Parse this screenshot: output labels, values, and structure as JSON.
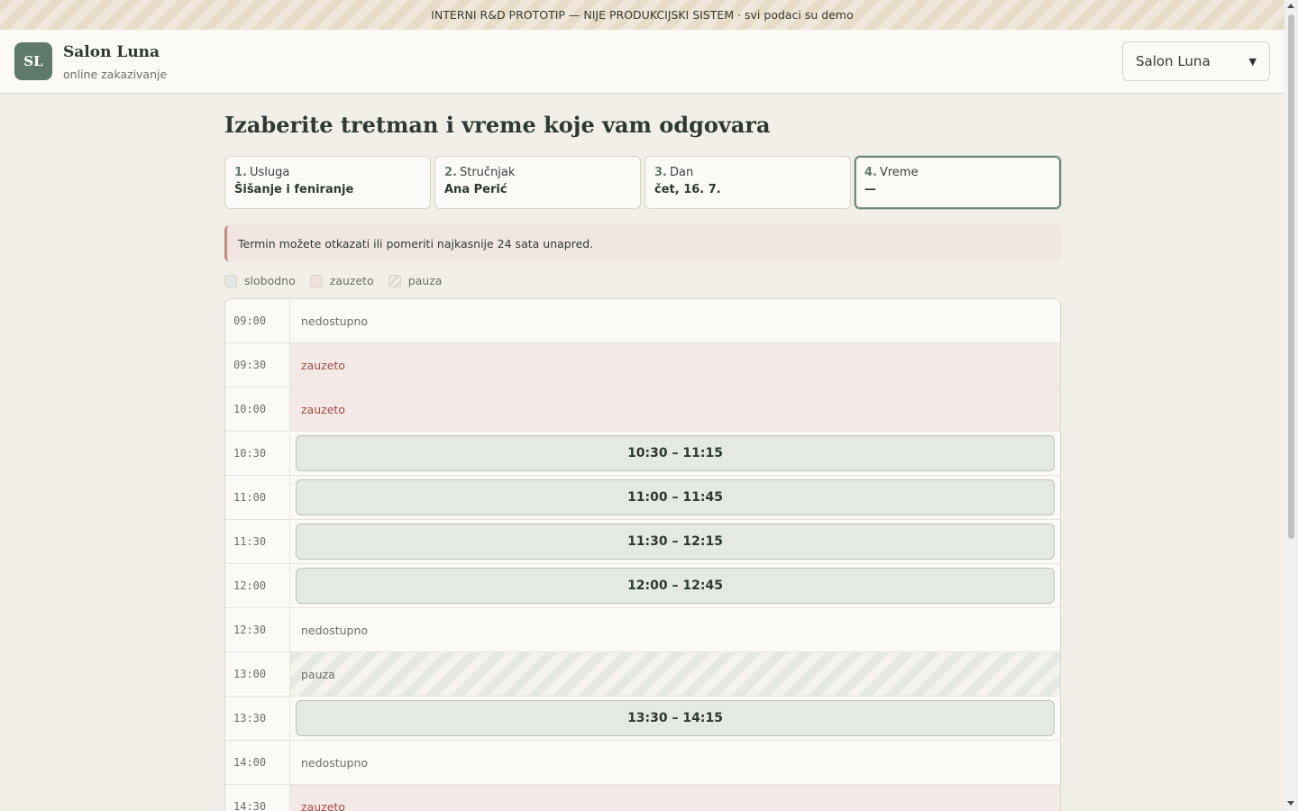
{
  "banner": "INTERNI R&D PROTOTIP — NIJE PRODUKCIJSKI SISTEM · svi podaci su demo",
  "header": {
    "logo": "SL",
    "brand_name": "Salon Luna",
    "brand_sub": "online zakazivanje",
    "salon_select": "Salon Luna"
  },
  "main": {
    "title": "Izaberite tretman i vreme koje vam odgovara",
    "steps": [
      {
        "num": "1.",
        "label": "Usluga",
        "value": "Šišanje i feniranje"
      },
      {
        "num": "2.",
        "label": "Stručnjak",
        "value": "Ana Perić"
      },
      {
        "num": "3.",
        "label": "Dan",
        "value": "čet, 16. 7."
      },
      {
        "num": "4.",
        "label": "Vreme",
        "value": "—"
      }
    ],
    "notice": "Termin možete otkazati ili pomeriti najkasnije 24 sata unapred.",
    "legend": {
      "free": "slobodno",
      "busy": "zauzeto",
      "pause": "pauza"
    },
    "rows": [
      {
        "time": "09:00",
        "text": "nedostupno"
      },
      {
        "time": "09:30",
        "text": "zauzeto"
      },
      {
        "time": "10:00",
        "text": "zauzeto"
      },
      {
        "time": "10:30",
        "text": "10:30 – 11:15"
      },
      {
        "time": "11:00",
        "text": "11:00 – 11:45"
      },
      {
        "time": "11:30",
        "text": "11:30 – 12:15"
      },
      {
        "time": "12:00",
        "text": "12:00 – 12:45"
      },
      {
        "time": "12:30",
        "text": "nedostupno"
      },
      {
        "time": "13:00",
        "text": "pauza"
      },
      {
        "time": "13:30",
        "text": "13:30 – 14:15"
      },
      {
        "time": "14:00",
        "text": "nedostupno"
      },
      {
        "time": "14:30",
        "text": "zauzeto"
      }
    ]
  }
}
